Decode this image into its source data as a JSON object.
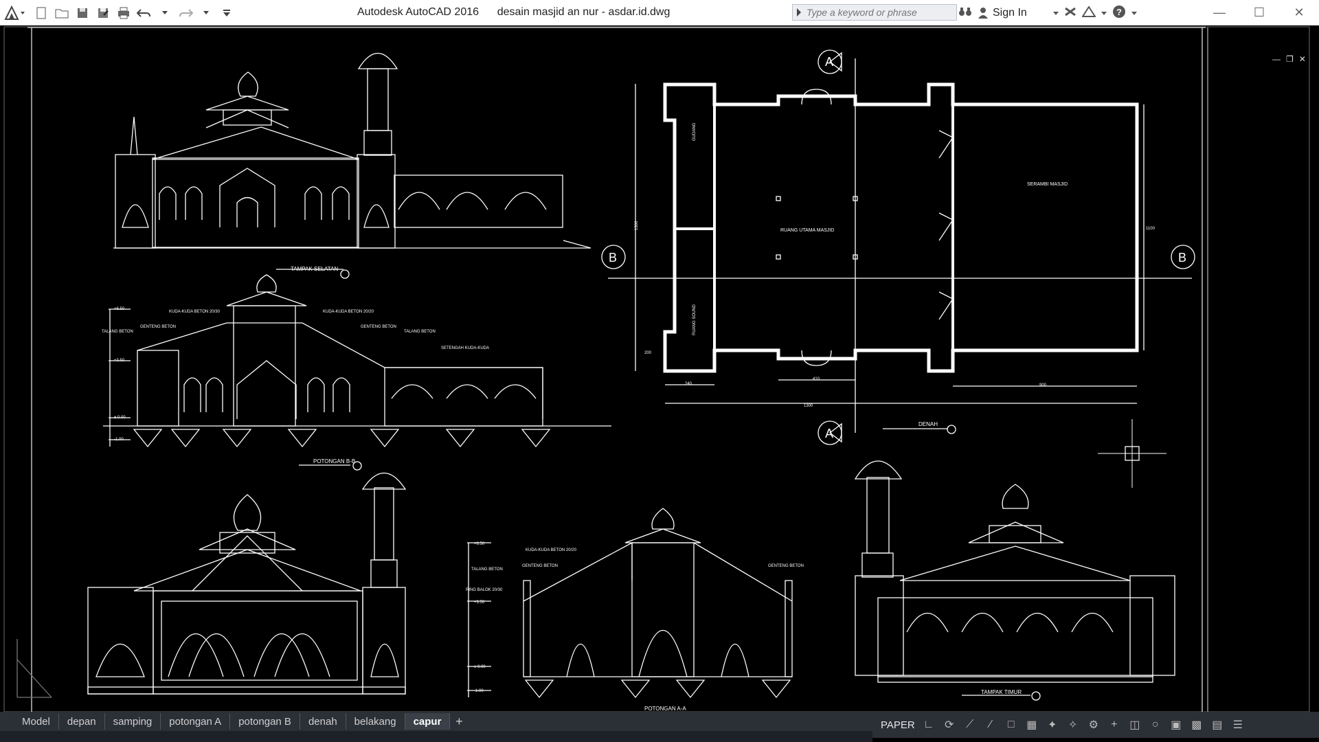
{
  "app": {
    "name": "Autodesk AutoCAD 2016",
    "filename": "desain masjid an nur - asdar.id.dwg"
  },
  "search": {
    "placeholder": "Type a keyword or phrase"
  },
  "header": {
    "sign_in": "Sign In"
  },
  "layout_tabs": [
    {
      "label": "Model",
      "active": false
    },
    {
      "label": "depan",
      "active": false
    },
    {
      "label": "samping",
      "active": false
    },
    {
      "label": "potongan A",
      "active": false
    },
    {
      "label": "potongan B",
      "active": false
    },
    {
      "label": "denah",
      "active": false
    },
    {
      "label": "belakang",
      "active": false
    },
    {
      "label": "capur",
      "active": true
    }
  ],
  "status": {
    "space": "PAPER"
  },
  "drawing": {
    "titles": {
      "south_elevation": "TAMPAK SELATAN",
      "section_bb": "POTONGAN B-B",
      "plan": "DENAH",
      "section_aa": "POTONGAN A-A",
      "east_elevation": "TAMPAK TIMUR"
    },
    "plan_labels": {
      "main_room": "RUANG UTAMA MASJID",
      "porch": "SERAMBI MASJID",
      "storage": "GUDANG",
      "sound_room": "RUANG SOUND",
      "section_a": "A",
      "section_b": "B",
      "dim_overall": "1300",
      "dim_height": "1100",
      "dim_left": "240",
      "dim_mid": "410",
      "dim_right": "900",
      "dim_side": "1300",
      "dim_small": "200"
    },
    "section_bb_labels": {
      "l1": "KUDA-KUDA BETON 20/30",
      "l2": "KUDA-KUDA BETON 20/20",
      "l3": "GENTENG BETON",
      "l4": "GENTENG BETON",
      "l5": "TALANG BETON",
      "l6": "TALANG BETON",
      "l7": "SETENGAH KUDA-KUDA",
      "lv1": "+6.50",
      "lv2": "+3.50",
      "lv3": "± 0.00",
      "lv4": "-1.00"
    },
    "section_aa_labels": {
      "l1": "KUDA-KUDA BETON 20/20",
      "l2": "GENTENG BETON",
      "l3": "GENTENG BETON",
      "l4": "TALANG BETON",
      "l5": "RING BALOK 20/30",
      "lv1": "+6.50",
      "lv2": "+3.50",
      "lv3": "± 0.00",
      "lv4": "-1.00"
    }
  }
}
